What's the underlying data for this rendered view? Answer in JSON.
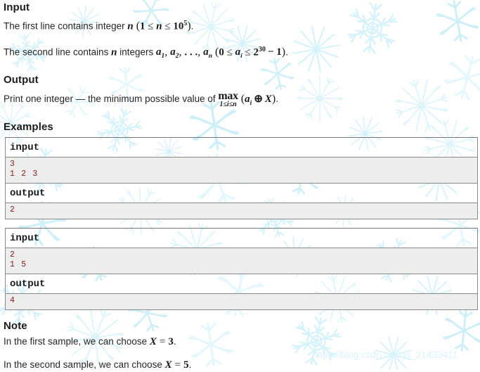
{
  "page": {
    "watermark": "https://blog.csdn.net/qq_21433411",
    "snow_color": "#d6f2fa",
    "body_text_color": "#262626",
    "heading_color": "#1c1c1c",
    "io_text_color": "#8a1c1c",
    "io_row_background": "#ededed",
    "border_color": "#888888"
  },
  "sections": {
    "input": {
      "heading": "Input",
      "lines": [
        {
          "prefix": "The first line contains integer ",
          "math": "n (1 ≤ n ≤ 10⁵).",
          "var": "n",
          "constraint_low": "1",
          "constraint_high": "10",
          "constraint_high_exp": "5"
        },
        {
          "prefix": "The second line contains ",
          "var": "n",
          "mid": " integers ",
          "terms": "a₁, a₂, …, aₙ",
          "constraint": "(0 ≤ aᵢ ≤ 2³⁰ − 1).",
          "constraint_low": "0",
          "constraint_high_base": "2",
          "constraint_high_exp": "30",
          "constraint_high_sub": "− 1"
        }
      ]
    },
    "output": {
      "heading": "Output",
      "line_prefix": "Print one integer — the minimum possible value of ",
      "formula": {
        "operator": "max",
        "limits": "1≤i≤n",
        "expression": "(aᵢ ⊕ X).",
        "xor_symbol": "⊕",
        "variable_a": "a",
        "variable_a_sub": "i",
        "variable_x": "X"
      }
    },
    "examples": {
      "heading": "Examples",
      "blocks": [
        {
          "input_label": "input",
          "input_data": "3\n1 2 3",
          "output_label": "output",
          "output_data": "2"
        },
        {
          "input_label": "input",
          "input_data": "2\n1 5",
          "output_label": "output",
          "output_data": "4"
        }
      ]
    },
    "note": {
      "heading": "Note",
      "lines": [
        {
          "prefix": "In the first sample, we can choose ",
          "math_var": "X",
          "math_eq": "=",
          "math_val": "3",
          "suffix": "."
        },
        {
          "prefix": "In the second sample, we can choose ",
          "math_var": "X",
          "math_eq": "=",
          "math_val": "5",
          "suffix": "."
        }
      ]
    }
  }
}
